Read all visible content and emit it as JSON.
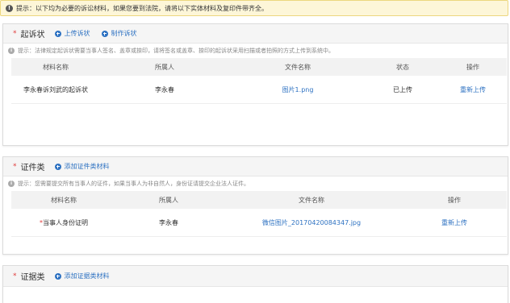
{
  "alert": {
    "text": "提示：以下均为必要的诉讼材料，如果您要到法院，请将以下实体材料及复印件带齐全。"
  },
  "complaint": {
    "title": "起诉状",
    "actions": [
      "上传诉状",
      "制作诉状"
    ],
    "hint": "提示：法律规定起诉状需要当事人签名、盖章或捺印，请将签名或盖章、捺印的起诉状采用扫描或者拍照的方式上传到系统中。",
    "columns": [
      "材料名称",
      "所属人",
      "文件名称",
      "状态",
      "操作"
    ],
    "rows": [
      {
        "name": "李永春诉刘武的起诉状",
        "owner": "李永春",
        "file": "图片1.png",
        "status": "已上传",
        "op": "重新上传"
      }
    ]
  },
  "certificates": {
    "title": "证件类",
    "action": "添加证件类材料",
    "hint": "提示：您需要提交所有当事人的证件，如果当事人为非自然人，身份证请提交企业法人证件。",
    "columns": [
      "材料名称",
      "所属人",
      "文件名称",
      "操作"
    ],
    "rows": [
      {
        "star": "*",
        "name": "当事人身份证明",
        "owner": "李永春",
        "file": "微信图片_20170420084347.jpg",
        "op": "重新上传"
      }
    ]
  },
  "evidence": {
    "title": "证据类",
    "action": "添加证据类材料"
  }
}
